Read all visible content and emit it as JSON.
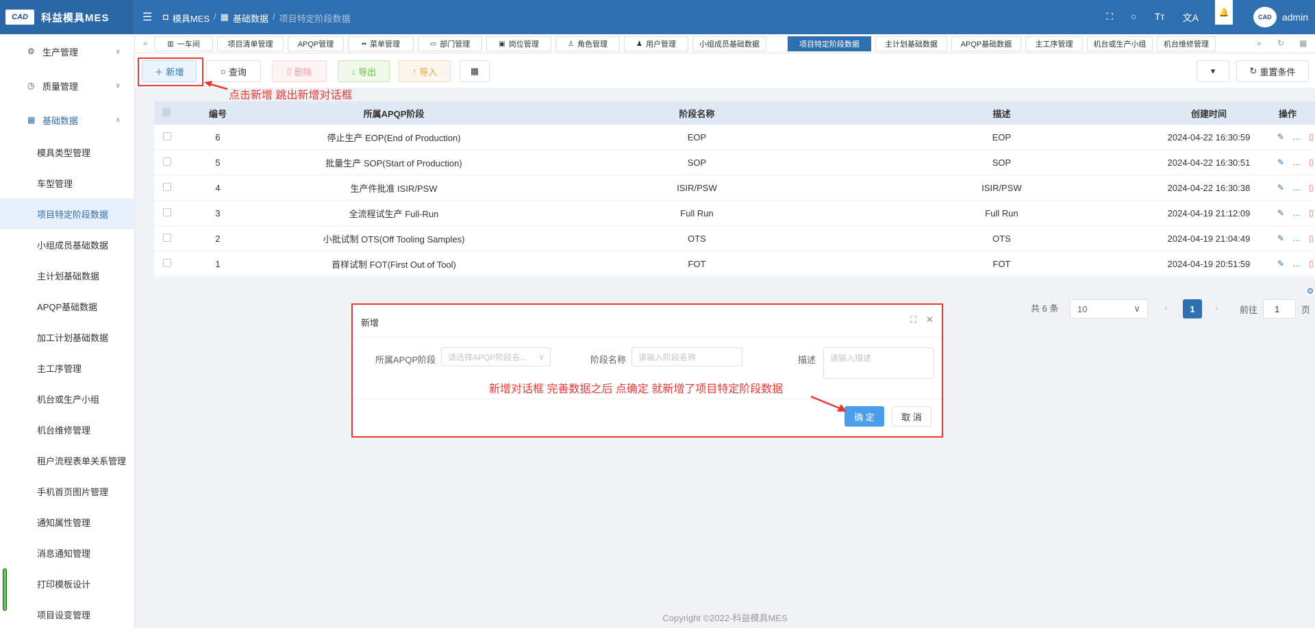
{
  "app": {
    "logo_text": "CAD",
    "title": "科益模具MES"
  },
  "breadcrumb": [
    "模具MES",
    "基础数据",
    "项目特定阶段数据"
  ],
  "top": {
    "username": "admin",
    "avatar_text": "CAD"
  },
  "sidebar": {
    "groups": [
      {
        "label": "生产管理",
        "icon": "gear-icon"
      },
      {
        "label": "质量管理",
        "icon": "clock-icon"
      },
      {
        "label": "基础数据",
        "icon": "calendar-icon"
      }
    ],
    "items": [
      {
        "label": "模具类型管理"
      },
      {
        "label": "车型管理"
      },
      {
        "label": "项目特定阶段数据"
      },
      {
        "label": "小组成员基础数据"
      },
      {
        "label": "主计划基础数据"
      },
      {
        "label": "APQP基础数据"
      },
      {
        "label": "加工计划基础数据"
      },
      {
        "label": "主工序管理"
      },
      {
        "label": "机台或生产小组"
      },
      {
        "label": "机台维修管理"
      },
      {
        "label": "租户流程表单关系管理"
      },
      {
        "label": "手机首页图片管理"
      },
      {
        "label": "通知属性管理"
      },
      {
        "label": "消息通知管理"
      },
      {
        "label": "打印模板设计"
      },
      {
        "label": "项目设变管理"
      }
    ]
  },
  "tabs": [
    {
      "label": "一车间",
      "icon": "bank-icon"
    },
    {
      "label": "项目清单管理",
      "icon": ""
    },
    {
      "label": "APQP管理",
      "icon": ""
    },
    {
      "label": "菜单管理",
      "icon": "grid-icon"
    },
    {
      "label": "部门管理",
      "icon": "dept-icon"
    },
    {
      "label": "岗位管理",
      "icon": "post-icon"
    },
    {
      "label": "角色管理",
      "icon": "role-icon"
    },
    {
      "label": "用户管理",
      "icon": "user-icon"
    },
    {
      "label": "小组成员基础数据",
      "icon": ""
    },
    {
      "label": "项目特定阶段数据",
      "icon": ""
    },
    {
      "label": "主计划基础数据",
      "icon": ""
    },
    {
      "label": "APQP基础数据",
      "icon": ""
    },
    {
      "label": "主工序管理",
      "icon": ""
    },
    {
      "label": "机台或生产小组",
      "icon": ""
    },
    {
      "label": "机台维修管理",
      "icon": ""
    }
  ],
  "toolbar": {
    "add": "新增",
    "query": "查询",
    "delete": "删除",
    "export": "导出",
    "import": "导入",
    "reset": "重置条件"
  },
  "annotations": {
    "add_hint": "点击新增 跳出新增对话框",
    "dialog_hint": "新增对话框 完善数据之后 点确定  就新增了项目特定阶段数据"
  },
  "table": {
    "columns": [
      "编号",
      "所属APQP阶段",
      "阶段名称",
      "描述",
      "创建时间",
      "操作"
    ],
    "rows": [
      {
        "id": "6",
        "apqp": "停止生产 EOP(End of Production)",
        "name": "EOP",
        "desc": "EOP",
        "created": "2024-04-22 16:30:59"
      },
      {
        "id": "5",
        "apqp": "批量生产 SOP(Start of Production)",
        "name": "SOP",
        "desc": "SOP",
        "created": "2024-04-22 16:30:51"
      },
      {
        "id": "4",
        "apqp": "生产件批准 ISIR/PSW",
        "name": "ISIR/PSW",
        "desc": "ISIR/PSW",
        "created": "2024-04-22 16:30:38"
      },
      {
        "id": "3",
        "apqp": "全流程试生产 Full-Run",
        "name": "Full Run",
        "desc": "Full Run",
        "created": "2024-04-19 21:12:09"
      },
      {
        "id": "2",
        "apqp": "小批试制 OTS(Off Tooling Samples)",
        "name": "OTS",
        "desc": "OTS",
        "created": "2024-04-19 21:04:49"
      },
      {
        "id": "1",
        "apqp": "首样试制 FOT(First Out of Tool)",
        "name": "FOT",
        "desc": "FOT",
        "created": "2024-04-19 20:51:59"
      }
    ]
  },
  "pager": {
    "total": "共 6 条",
    "page_size": "10",
    "current": "1",
    "goto_label": "前往",
    "goto_value": "1",
    "page_suffix": "页"
  },
  "dialog": {
    "title": "新增",
    "apqp_label": "所属APQP阶段",
    "apqp_placeholder": "请选择APQP阶段名...",
    "name_label": "阶段名称",
    "name_placeholder": "请输入阶段名称",
    "desc_label": "描述",
    "desc_placeholder": "请输入描述",
    "ok": "确 定",
    "cancel": "取 消"
  },
  "footer": "Copyright ©2022-科益模具MES",
  "colors": {
    "primary": "#2d6fb0",
    "annotation": "#e53935"
  }
}
